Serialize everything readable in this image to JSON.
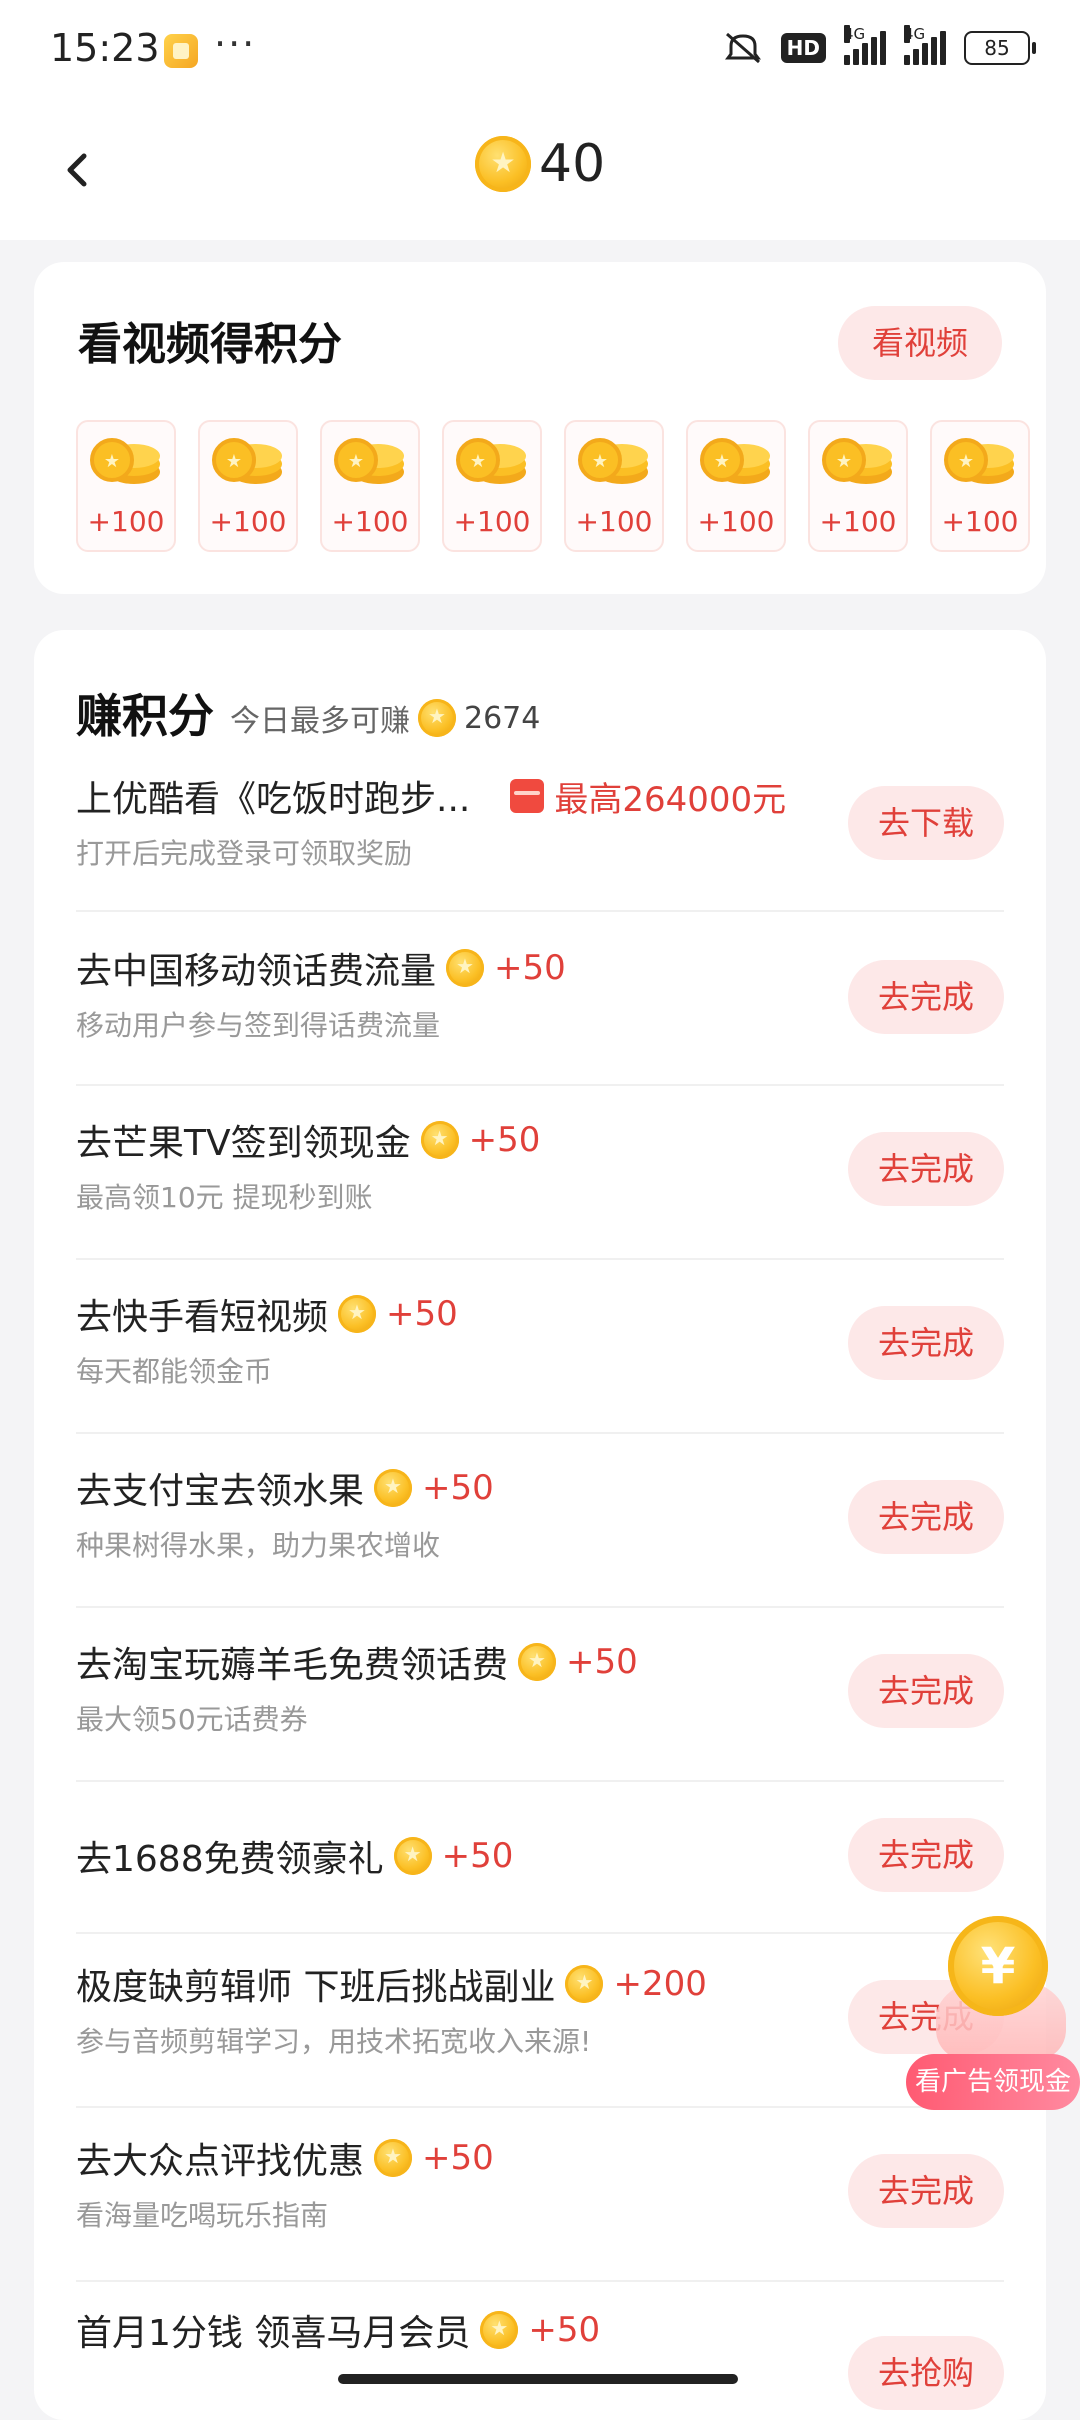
{
  "status_bar": {
    "time": "15:23",
    "more": "···",
    "hd_badge": "HD",
    "network_label_1": "4G",
    "network_label_2": "4G",
    "battery": "85"
  },
  "header": {
    "points": "40"
  },
  "video_card": {
    "title": "看视频得积分",
    "button_label": "看视频",
    "rewards": [
      "+100",
      "+100",
      "+100",
      "+100",
      "+100",
      "+100",
      "+100",
      "+100"
    ]
  },
  "earn_card": {
    "title": "赚积分",
    "subtitle": "今日最多可赚",
    "max_points": "2674",
    "tasks": [
      {
        "title": "上优酷看《吃饭时跑步...",
        "reward": "最高264000元",
        "desc": "打开后完成登录可领取奖励",
        "button": "去下载"
      },
      {
        "title": "去中国移动领话费流量",
        "reward": "+50",
        "desc": "移动用户参与签到得话费流量",
        "button": "去完成"
      },
      {
        "title": "去芒果TV签到领现金",
        "reward": "+50",
        "desc": "最高领10元 提现秒到账",
        "button": "去完成"
      },
      {
        "title": "去快手看短视频",
        "reward": "+50",
        "desc": "每天都能领金币",
        "button": "去完成"
      },
      {
        "title": "去支付宝去领水果",
        "reward": "+50",
        "desc": "种果树得水果，助力果农增收",
        "button": "去完成"
      },
      {
        "title": "去淘宝玩薅羊毛免费领话费",
        "reward": "+50",
        "desc": "最大领50元话费券",
        "button": "去完成"
      },
      {
        "title": "去1688免费领豪礼",
        "reward": "+50",
        "desc": "",
        "button": "去完成"
      },
      {
        "title": "极度缺剪辑师 下班后挑战副业",
        "reward": "+200",
        "desc": "参与音频剪辑学习，用技术拓宽收入来源!",
        "button": "去完成"
      },
      {
        "title": "去大众点评找优惠",
        "reward": "+50",
        "desc": "看海量吃喝玩乐指南",
        "button": "去完成"
      },
      {
        "title": "首月1分钱 领喜马月会员",
        "reward": "+50",
        "desc": "",
        "button": "去抢购"
      }
    ]
  },
  "floating_widget": {
    "symbol": "¥",
    "label": "看广告领现金"
  }
}
